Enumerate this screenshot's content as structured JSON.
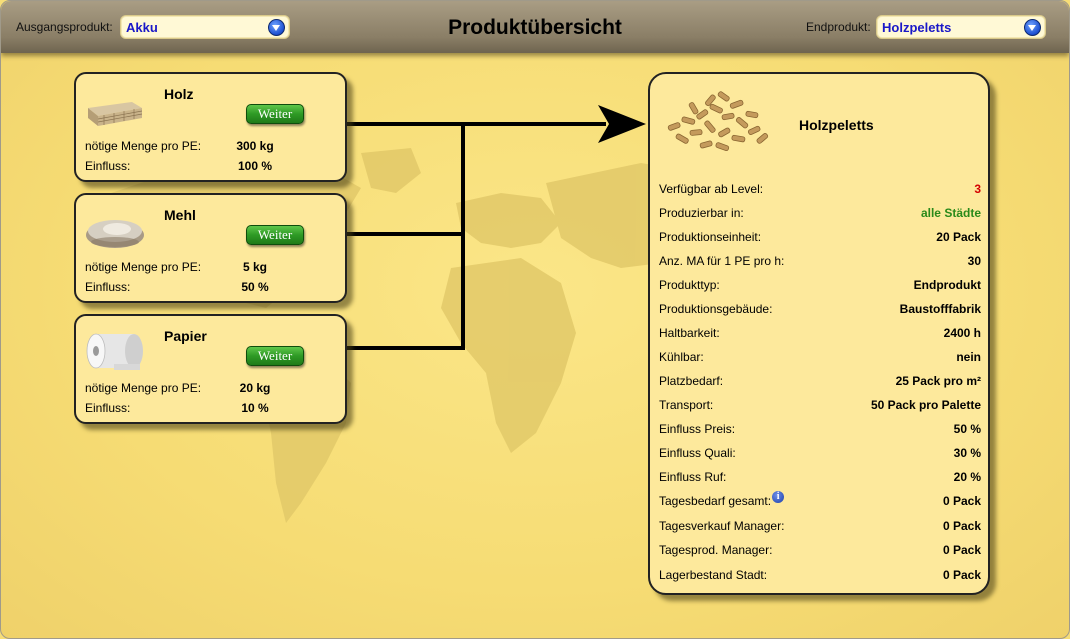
{
  "header": {
    "source_label": "Ausgangsprodukt:",
    "source_value": "Akku",
    "title": "Produktübersicht",
    "target_label": "Endprodukt:",
    "target_value": "Holzpeletts"
  },
  "ingredients": [
    {
      "name": "Holz",
      "icon": "wood-planks-image",
      "button": "Weiter",
      "amount_label": "nötige Menge pro PE:",
      "amount": "300 kg",
      "influence_label": "Einfluss:",
      "influence": "100 %"
    },
    {
      "name": "Mehl",
      "icon": "flour-bowl-image",
      "button": "Weiter",
      "amount_label": "nötige Menge pro PE:",
      "amount": "5 kg",
      "influence_label": "Einfluss:",
      "influence": "50 %"
    },
    {
      "name": "Papier",
      "icon": "paper-roll-image",
      "button": "Weiter",
      "amount_label": "nötige Menge pro PE:",
      "amount": "20 kg",
      "influence_label": "Einfluss:",
      "influence": "10 %"
    }
  ],
  "product": {
    "name": "Holzpeletts",
    "icon": "wood-pellets-image",
    "details": [
      {
        "label": "Verfügbar ab Level:",
        "value": "3",
        "color": "#d40000"
      },
      {
        "label": "Produzierbar in:",
        "value": "alle Städte",
        "color": "#2a8a1a"
      },
      {
        "label": "Produktionseinheit:",
        "value": "20 Pack"
      },
      {
        "label": "Anz. MA für 1 PE pro h:",
        "value": "30"
      },
      {
        "label": "Produkttyp:",
        "value": "Endprodukt"
      },
      {
        "label": "Produktionsgebäude:",
        "value": "Baustofffabrik"
      },
      {
        "label": "Haltbarkeit:",
        "value": "2400 h"
      },
      {
        "label": "Kühlbar:",
        "value": "nein"
      },
      {
        "label": "Platzbedarf:",
        "value": "25 Pack pro m²"
      },
      {
        "label": "Transport:",
        "value": "50 Pack pro Palette"
      },
      {
        "label": "Einfluss Preis:",
        "value": "50 %"
      },
      {
        "label": "Einfluss Quali:",
        "value": "30 %"
      },
      {
        "label": "Einfluss Ruf:",
        "value": "20 %"
      },
      {
        "label": "Tagesbedarf gesamt:",
        "value": "0 Pack",
        "info": "i"
      },
      {
        "label": "Tagesverkauf Manager:",
        "value": "0 Pack"
      },
      {
        "label": "Tagesprod. Manager:",
        "value": "0 Pack"
      },
      {
        "label": "Lagerbestand Stadt:",
        "value": "0 Pack"
      }
    ]
  },
  "colors": {
    "background": "#f7de78",
    "card": "#fde99c",
    "button_green": "#2e9a25",
    "select_text": "#1a18c8"
  }
}
